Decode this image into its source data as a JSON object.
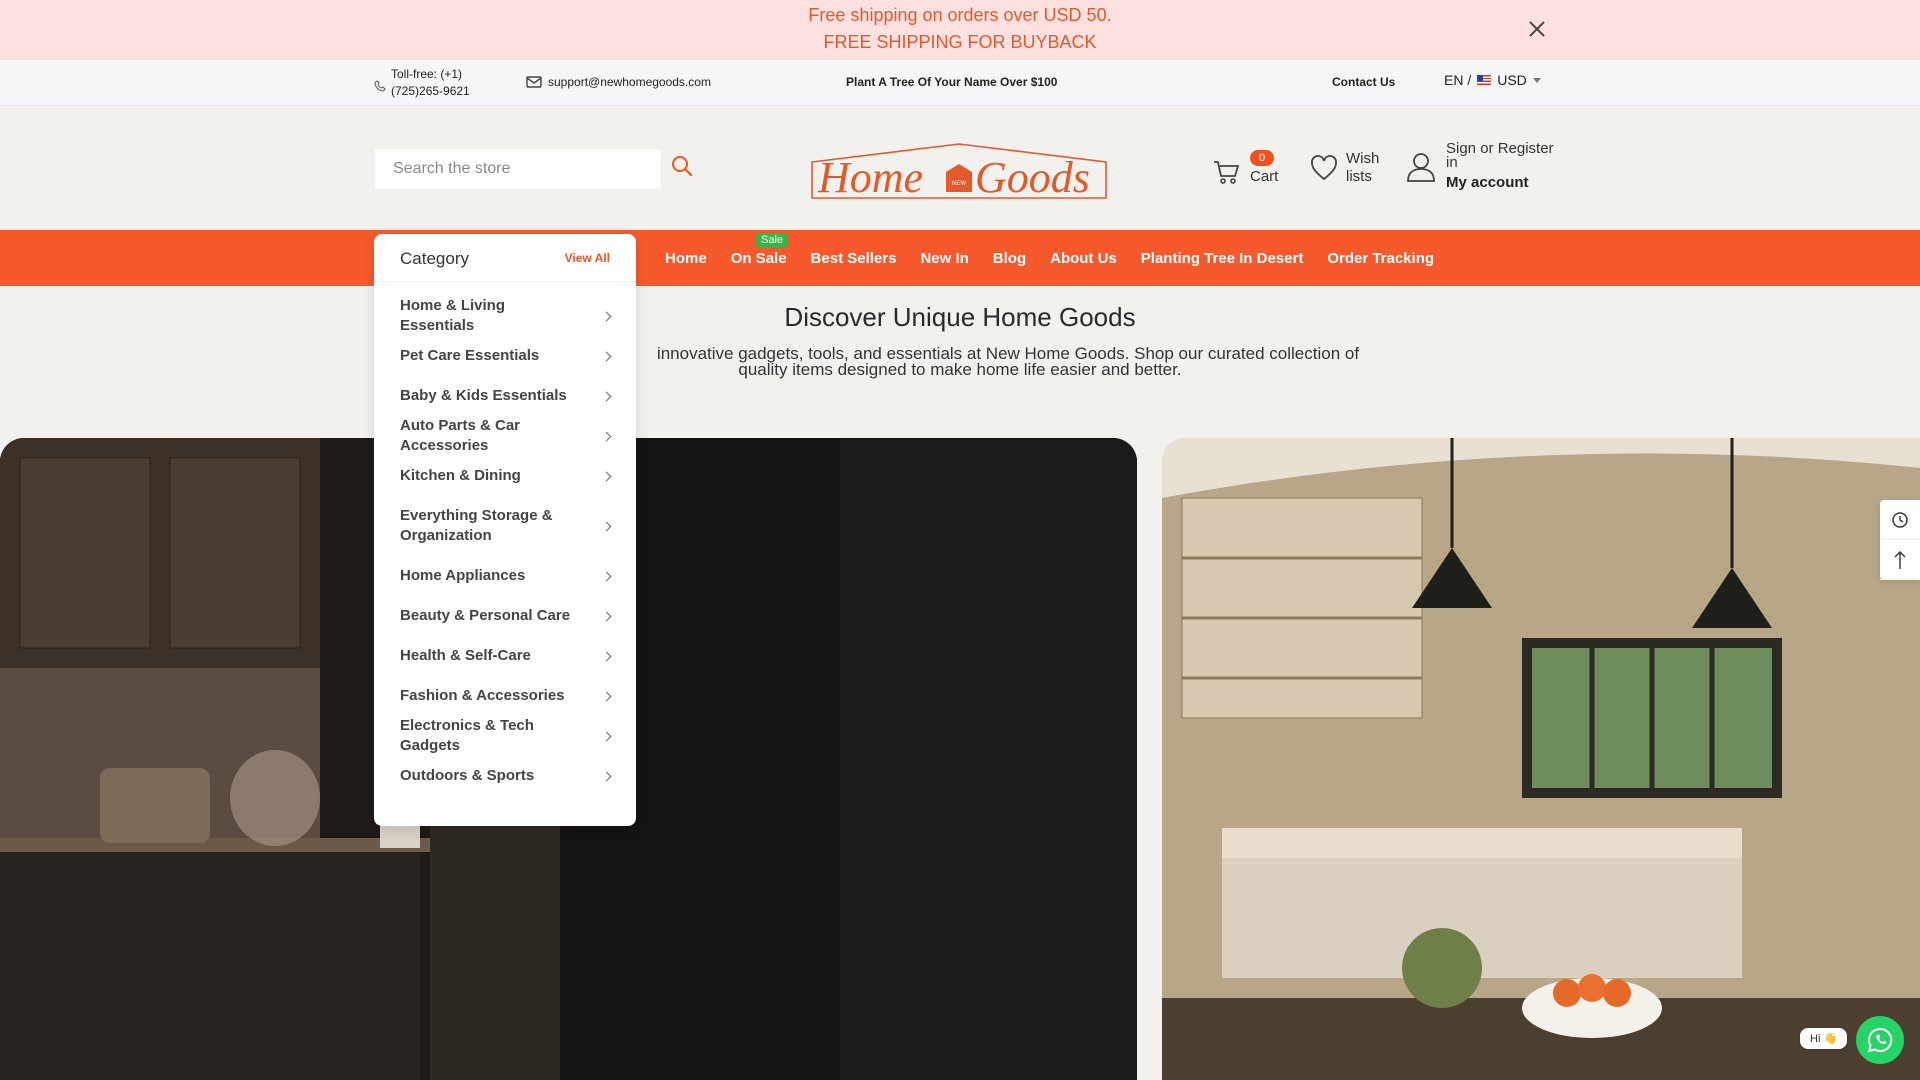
{
  "announcement": {
    "line1": "Free shipping on orders over USD 50.",
    "line2": "FREE SHIPPING FOR BUYBACK"
  },
  "infobar": {
    "phone_line1": "Toll-free: (+1)",
    "phone_line2": "(725)265-9621",
    "email": "support@newhomegoods.com",
    "promo": "Plant A Tree Of Your Name Over $100",
    "contact": "Contact Us",
    "language": "EN /",
    "currency": "USD"
  },
  "header": {
    "search_placeholder": "Search the store",
    "logo_text_left": "Home",
    "logo_badge": "NEW",
    "logo_text_right": "Goods",
    "cart_count": "0",
    "cart_label": "Cart",
    "wish_line1": "Wish",
    "wish_line2": "lists",
    "account_line1": "Sign or Register",
    "account_line1b": "in",
    "account_line2": "My account"
  },
  "nav": {
    "sale_badge": "Sale",
    "links": [
      "Home",
      "On Sale",
      "Best Sellers",
      "New In",
      "Blog",
      "About Us",
      "Planting Tree In Desert",
      "Order Tracking"
    ]
  },
  "category": {
    "title": "Category",
    "view_all": "View All",
    "items": [
      "Home & Living Essentials",
      "Pet Care Essentials",
      "Baby & Kids Essentials",
      "Auto Parts & Car Accessories",
      "Kitchen & Dining",
      "Everything Storage & Organization",
      "Home Appliances",
      "Beauty & Personal Care",
      "Health & Self-Care",
      "Fashion & Accessories",
      "Electronics & Tech Gadgets",
      "Outdoors & Sports"
    ]
  },
  "hero": {
    "title": "Discover Unique Home Goods",
    "subtitle_line1": "innovative gadgets, tools, and essentials at New Home Goods. Shop our curated collection of",
    "subtitle_line2": "quality items designed to make home life easier and better."
  },
  "chat": {
    "greeting": "Hi 👋"
  },
  "colors": {
    "accent": "#f65a2c",
    "announcement_bg": "#fde0df",
    "sale_badge": "#39b449",
    "whatsapp": "#25d366"
  }
}
